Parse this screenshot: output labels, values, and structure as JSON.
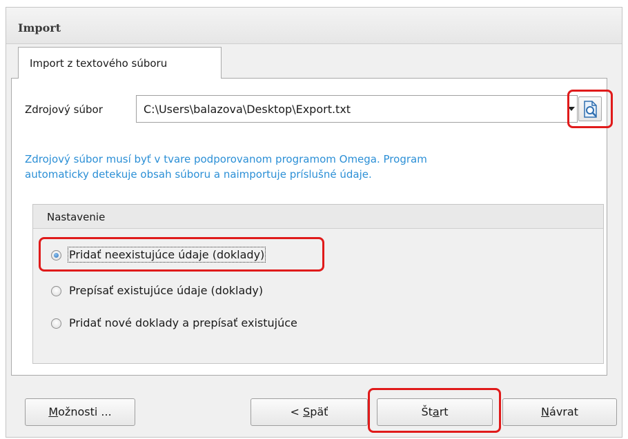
{
  "window": {
    "title": "Import"
  },
  "tab": {
    "label": "Import z textového súboru"
  },
  "source": {
    "label": "Zdrojový súbor",
    "path": "C:\\Users\\balazova\\Desktop\\Export.txt"
  },
  "info": {
    "line1": "Zdrojový súbor musí byť v tvare podporovanom programom Omega. Program",
    "line2": "automaticky detekuje obsah súboru a naimportuje príslušné údaje."
  },
  "settings": {
    "title": "Nastavenie",
    "options": [
      {
        "label": "Pridať neexistujúce údaje (doklady)",
        "checked": true
      },
      {
        "label": "Prepísať existujúce údaje (doklady)",
        "checked": false
      },
      {
        "label": "Pridať nové doklady a prepísať existujúce",
        "checked": false
      }
    ]
  },
  "buttons": {
    "options": {
      "pre": "",
      "key": "M",
      "post": "ožnosti ..."
    },
    "back": {
      "pre": "< ",
      "key": "S",
      "post": "päť"
    },
    "start": {
      "pre": "Št",
      "key": "a",
      "post": "rt"
    },
    "return": {
      "pre": "",
      "key": "N",
      "post": "ávrat"
    }
  },
  "colors": {
    "info_text": "#2b8fd6",
    "highlight": "#e01a1a",
    "radio_selected": "#2b6fb9"
  },
  "icons": {
    "browse": "file-preview-icon"
  }
}
